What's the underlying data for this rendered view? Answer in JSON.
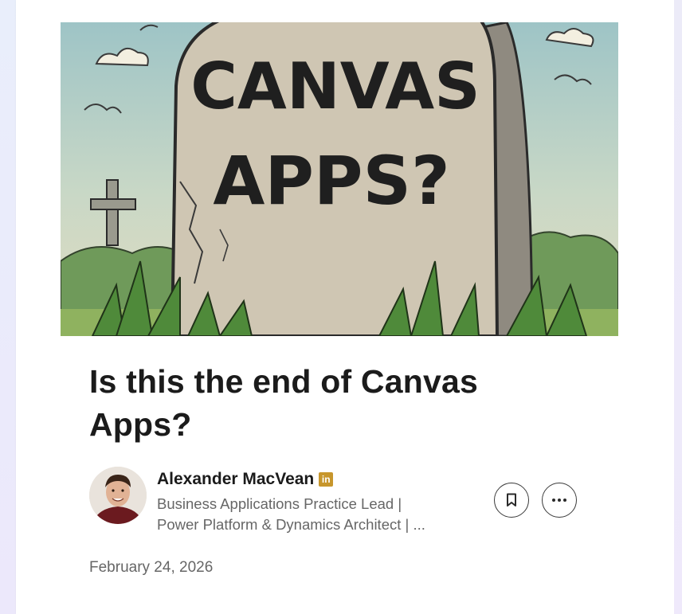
{
  "article": {
    "hero_text_line1": "CANVAS",
    "hero_text_line2": "APPS?",
    "title": "Is this the end of Canvas Apps?",
    "date": "February 24, 2026"
  },
  "author": {
    "name": "Alexander MacVean",
    "badge": "in",
    "headline_line1": "Business Applications Practice Lead |",
    "headline_line2": "Power Platform & Dynamics Architect | ..."
  },
  "actions": {
    "save_icon": "bookmark-icon",
    "more_icon": "more-horizontal-icon"
  },
  "colors": {
    "sky": "#a9c9c9",
    "grass": "#6f9a5a",
    "stone": "#cfc6b3",
    "badge": "#c7962c"
  }
}
